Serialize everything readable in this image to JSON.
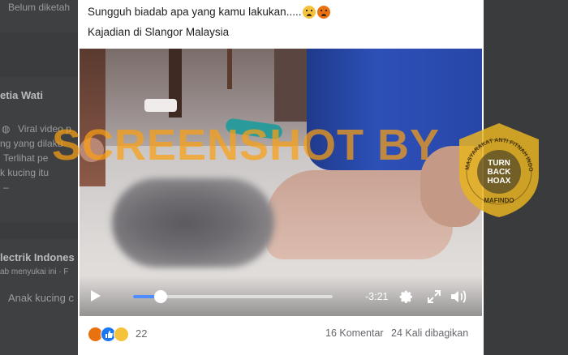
{
  "background_feed": {
    "top_snippet": "Belum diketah",
    "author_1": "etia Wati",
    "line_1": "Viral video p",
    "line_2": "ng yang dilaku",
    "line_3": "Terlihat pe",
    "line_4": "k kucing itu",
    "line_5": "–",
    "author_2": "lectrik Indones",
    "line_6": "ab menyukai ini · F",
    "line_7": "Anak kucing c"
  },
  "post": {
    "line_1": "Sungguh biadab apa yang kamu lakukan.....",
    "line_1_emojis": [
      "crying-face",
      "angry-face"
    ],
    "line_2": "Kajadian di Slangor Malaysia"
  },
  "video": {
    "watermark": "SCREENSHOT BY",
    "badge": {
      "arc_text": "MASYARAKAT ANTI FITNAH INDONESIA",
      "center_line_1": "TURN",
      "center_line_2": "BACK",
      "center_line_3": "HOAX",
      "bottom_text": "MAFINDO"
    },
    "controls": {
      "time_remaining": "-3:21",
      "progress_fraction": 0.14
    }
  },
  "footer": {
    "reactions": [
      "angry",
      "like",
      "sad"
    ],
    "reaction_count": "22",
    "comments": "16 Komentar",
    "shares": "24 Kali dibagikan"
  },
  "colors": {
    "accent": "#1877f2",
    "progress": "#4f8cff",
    "watermark": "#faa014",
    "badge": "#e8b422"
  }
}
